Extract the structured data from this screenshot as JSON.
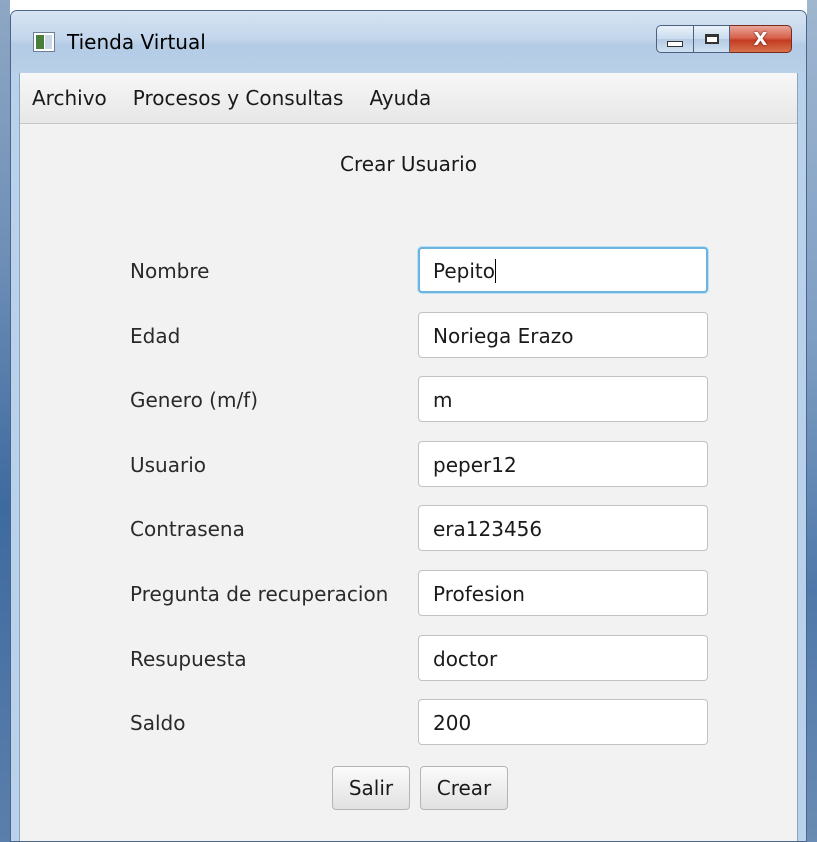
{
  "window": {
    "title": "Tienda Virtual",
    "close_glyph": "X"
  },
  "menu": {
    "items": [
      "Archivo",
      "Procesos y Consultas",
      "Ayuda"
    ]
  },
  "form": {
    "title": "Crear Usuario",
    "fields": [
      {
        "label": "Nombre",
        "value": "Pepito"
      },
      {
        "label": "Edad",
        "value": "Noriega Erazo"
      },
      {
        "label": "Genero (m/f)",
        "value": "m"
      },
      {
        "label": "Usuario",
        "value": "peper12"
      },
      {
        "label": "Contrasena",
        "value": "era123456"
      },
      {
        "label": "Pregunta de recuperacion",
        "value": "Profesion"
      },
      {
        "label": "Resupuesta",
        "value": "doctor"
      },
      {
        "label": "Saldo",
        "value": "200"
      }
    ]
  },
  "buttons": {
    "salir": "Salir",
    "crear": "Crear"
  },
  "icons": {
    "app": "window-app-icon",
    "minimize": "minimize-icon",
    "maximize": "maximize-icon",
    "close": "close-icon"
  },
  "colors": {
    "focus_border": "#6cb4e0",
    "close_button": "#c43b22"
  }
}
